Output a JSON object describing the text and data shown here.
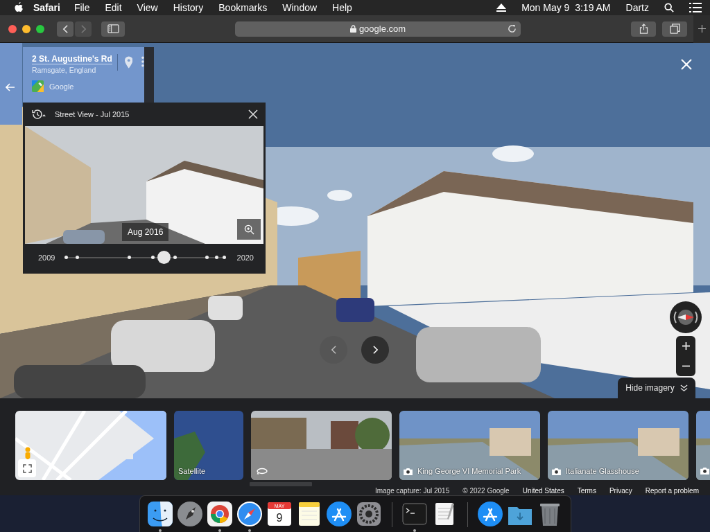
{
  "menu_bar": {
    "app": "Safari",
    "menus": [
      "File",
      "Edit",
      "View",
      "History",
      "Bookmarks",
      "Window",
      "Help"
    ],
    "clock": "Mon May 9  3:19 AM",
    "user": "Dartz"
  },
  "toolbar": {
    "back_disabled": false,
    "forward_disabled": true,
    "address": "google.com"
  },
  "place_card": {
    "title": "2 St. Augustine's Rd",
    "subtitle": "Ramsgate, England",
    "source": "Google"
  },
  "time_travel": {
    "title": "Street View - Jul 2015",
    "preview_date": "Aug 2016",
    "start_year": "2009",
    "end_year": "2020",
    "level": 0.62
  },
  "imagery_toggle": {
    "label": "Hide imagery"
  },
  "thumbnails": [
    {
      "kind": "map"
    },
    {
      "kind": "satellite",
      "label": "Satellite"
    },
    {
      "kind": "streetview"
    },
    {
      "kind": "photo",
      "label": "King George VI Memorial Park"
    },
    {
      "kind": "photo",
      "label": "Italianate Glasshouse"
    },
    {
      "kind": "photo"
    }
  ],
  "footer": [
    {
      "text": "Image capture: Jul 2015",
      "kind": "text"
    },
    {
      "text": "© 2022 Google",
      "kind": "text"
    },
    {
      "text": "United States",
      "kind": "link"
    },
    {
      "text": "Terms",
      "kind": "link"
    },
    {
      "text": "Privacy",
      "kind": "link"
    },
    {
      "text": "Report a problem",
      "kind": "link"
    }
  ],
  "dock": [
    {
      "kind": "finder",
      "running": true
    },
    {
      "kind": "launchpad",
      "running": false
    },
    {
      "kind": "chrome",
      "running": true
    },
    {
      "kind": "safari",
      "running": true
    },
    {
      "kind": "calendar",
      "month": "MAY",
      "day": "9",
      "running": false
    },
    {
      "kind": "notes",
      "running": false
    },
    {
      "kind": "appstore",
      "running": false
    },
    {
      "kind": "settings",
      "running": false
    },
    {
      "kind": "separator"
    },
    {
      "kind": "terminal",
      "running": true
    },
    {
      "kind": "textedit",
      "running": false
    },
    {
      "kind": "separator"
    },
    {
      "kind": "appstore",
      "running": false
    },
    {
      "kind": "downloads",
      "running": false
    },
    {
      "kind": "trash",
      "running": false
    }
  ]
}
